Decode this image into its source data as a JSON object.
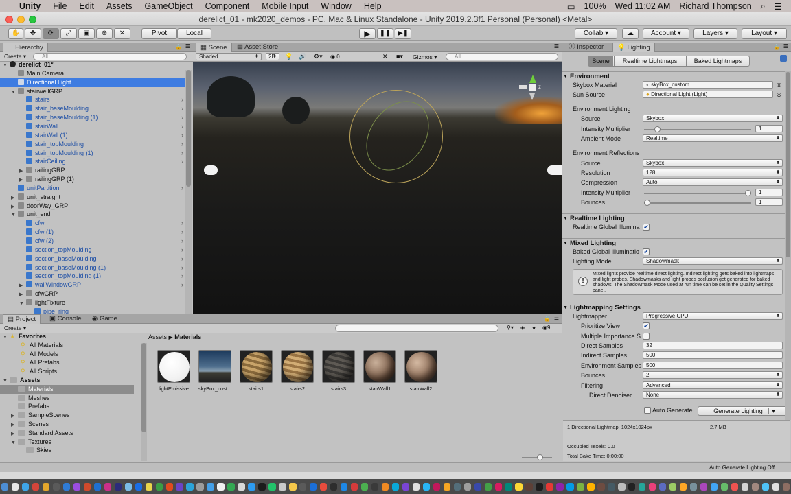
{
  "menubar": {
    "apple": "",
    "app": "Unity",
    "items": [
      "File",
      "Edit",
      "Assets",
      "GameObject",
      "Component",
      "Mobile Input",
      "Window",
      "Help"
    ],
    "battery": "100%",
    "clock": "Wed 11:02 AM",
    "user": "Richard Thompson"
  },
  "window": {
    "title": "derelict_01 - mk2020_demos - PC, Mac & Linux Standalone - Unity 2019.2.3f1 Personal (Personal) <Metal>"
  },
  "toolbar": {
    "pivot": "Pivot",
    "local": "Local",
    "collab": "Collab",
    "account": "Account",
    "layers": "Layers",
    "layout": "Layout"
  },
  "hierarchy": {
    "tab": "Hierarchy",
    "create": "Create",
    "search_placeholder": "All",
    "rows": [
      {
        "label": "derelict_01*",
        "indent": 0,
        "arrow": "▼",
        "icon": "unity",
        "bold": true
      },
      {
        "label": "Main Camera",
        "indent": 1,
        "arrow": "",
        "icon": "go"
      },
      {
        "label": "Directional Light",
        "indent": 1,
        "arrow": "",
        "icon": "go",
        "selected": true
      },
      {
        "label": "stairwellGRP",
        "indent": 1,
        "arrow": "▼",
        "icon": "go"
      },
      {
        "label": "stairs",
        "indent": 2,
        "arrow": "",
        "icon": "prefab",
        "chev": true
      },
      {
        "label": "stair_baseMoulding",
        "indent": 2,
        "arrow": "",
        "icon": "prefab",
        "chev": true
      },
      {
        "label": "stair_baseMoulding (1)",
        "indent": 2,
        "arrow": "",
        "icon": "prefab",
        "chev": true
      },
      {
        "label": "stairWall",
        "indent": 2,
        "arrow": "",
        "icon": "prefab",
        "chev": true
      },
      {
        "label": "stairWall (1)",
        "indent": 2,
        "arrow": "",
        "icon": "prefab",
        "chev": true
      },
      {
        "label": "stair_topMoulding",
        "indent": 2,
        "arrow": "",
        "icon": "prefab",
        "chev": true
      },
      {
        "label": "stair_topMoulding (1)",
        "indent": 2,
        "arrow": "",
        "icon": "prefab",
        "chev": true
      },
      {
        "label": "stairCeiling",
        "indent": 2,
        "arrow": "",
        "icon": "prefab",
        "chev": true
      },
      {
        "label": "railingGRP",
        "indent": 2,
        "arrow": "▶",
        "icon": "go"
      },
      {
        "label": "railingGRP (1)",
        "indent": 2,
        "arrow": "▶",
        "icon": "go"
      },
      {
        "label": "unitPartition",
        "indent": 1,
        "arrow": "",
        "icon": "prefab",
        "chev": true
      },
      {
        "label": "unit_straight",
        "indent": 1,
        "arrow": "▶",
        "icon": "go"
      },
      {
        "label": "doorWay_GRP",
        "indent": 1,
        "arrow": "▶",
        "icon": "go"
      },
      {
        "label": "unit_end",
        "indent": 1,
        "arrow": "▼",
        "icon": "go"
      },
      {
        "label": "cfw",
        "indent": 2,
        "arrow": "",
        "icon": "prefab",
        "chev": true
      },
      {
        "label": "cfw (1)",
        "indent": 2,
        "arrow": "",
        "icon": "prefab",
        "chev": true
      },
      {
        "label": "cfw (2)",
        "indent": 2,
        "arrow": "",
        "icon": "prefab",
        "chev": true
      },
      {
        "label": "section_topMoulding",
        "indent": 2,
        "arrow": "",
        "icon": "prefab",
        "chev": true
      },
      {
        "label": "section_baseMoulding",
        "indent": 2,
        "arrow": "",
        "icon": "prefab",
        "chev": true
      },
      {
        "label": "section_baseMoulding (1)",
        "indent": 2,
        "arrow": "",
        "icon": "prefab",
        "chev": true
      },
      {
        "label": "section_topMoulding (1)",
        "indent": 2,
        "arrow": "",
        "icon": "prefab",
        "chev": true
      },
      {
        "label": "wallWindowGRP",
        "indent": 2,
        "arrow": "▶",
        "icon": "prefab",
        "chev": true
      },
      {
        "label": "cfwGRP",
        "indent": 2,
        "arrow": "▶",
        "icon": "go"
      },
      {
        "label": "lightFixture",
        "indent": 2,
        "arrow": "▼",
        "icon": "go"
      },
      {
        "label": "pipe_ring",
        "indent": 3,
        "arrow": "",
        "icon": "prefab"
      }
    ]
  },
  "scene": {
    "tab_scene": "Scene",
    "tab_store": "Asset Store",
    "shading": "Shaded",
    "mode2d": "2D",
    "fx_count": "0",
    "gizmos": "Gizmos",
    "search_placeholder": "All",
    "persp_label": "z"
  },
  "project": {
    "tab_project": "Project",
    "tab_console": "Console",
    "tab_game": "Game",
    "create": "Create",
    "badge": "9",
    "breadcrumb": [
      "Assets",
      "Materials"
    ],
    "favorites": {
      "label": "Favorites",
      "items": [
        "All Materials",
        "All Models",
        "All Prefabs",
        "All Scripts"
      ]
    },
    "assets": {
      "label": "Assets",
      "items": [
        {
          "label": "Materials",
          "selected": true
        },
        {
          "label": "Meshes"
        },
        {
          "label": "Prefabs"
        },
        {
          "label": "SampleScenes",
          "arrow": true
        },
        {
          "label": "Scenes",
          "arrow": true
        },
        {
          "label": "Standard Assets",
          "arrow": true
        },
        {
          "label": "Textures",
          "arrow": true,
          "open": true
        }
      ],
      "sub": "Skies"
    },
    "materials": [
      {
        "name": "lightEmissive",
        "style": "white"
      },
      {
        "name": "skyBox_cust...",
        "style": "sky"
      },
      {
        "name": "stairs1",
        "style": "wood1"
      },
      {
        "name": "stairs2",
        "style": "wood2"
      },
      {
        "name": "stairs3",
        "style": "dark"
      },
      {
        "name": "stairWall1",
        "style": "wall1"
      },
      {
        "name": "stairWall2",
        "style": "wall2"
      }
    ]
  },
  "inspector": {
    "tab_inspector": "Inspector",
    "tab_lighting": "Lighting",
    "subtabs": [
      "Scene",
      "Realtime Lightmaps",
      "Baked Lightmaps"
    ],
    "environment": {
      "header": "Environment",
      "skybox_label": "Skybox Material",
      "skybox_value": "skyBox_custom",
      "sun_label": "Sun Source",
      "sun_value": "Directional Light (Light)",
      "env_lighting": "Environment Lighting",
      "source_label": "Source",
      "source_value": "Skybox",
      "intensity_label": "Intensity Multiplier",
      "intensity_value": "1",
      "intensity_level": 0.1,
      "ambient_label": "Ambient Mode",
      "ambient_value": "Realtime",
      "env_reflections": "Environment Reflections",
      "r_source_label": "Source",
      "r_source_value": "Skybox",
      "resolution_label": "Resolution",
      "resolution_value": "128",
      "compression_label": "Compression",
      "compression_value": "Auto",
      "r_intensity_label": "Intensity Multiplier",
      "r_intensity_value": "1",
      "r_intensity_level": 1.0,
      "bounces_label": "Bounces",
      "bounces_value": "1",
      "bounces_level": 0.0
    },
    "realtime": {
      "header": "Realtime Lighting",
      "gi_label": "Realtime Global Illumina",
      "gi_checked": "✔"
    },
    "mixed": {
      "header": "Mixed Lighting",
      "baked_label": "Baked Global Illuminatio",
      "baked_checked": "✔",
      "mode_label": "Lighting Mode",
      "mode_value": "Shadowmask",
      "info": "Mixed lights provide realtime direct lighting. Indirect lighting gets baked into lightmaps and light probes. Shadowmasks and light probes occlusion get generated for baked shadows. The Shadowmask Mode used at run time can be set in the Quality Settings panel."
    },
    "lightmapping": {
      "header": "Lightmapping Settings",
      "lightmapper_label": "Lightmapper",
      "lightmapper_value": "Progressive CPU",
      "prioritize_label": "Prioritize View",
      "prioritize_checked": "✔",
      "importance_label": "Multiple Importance S",
      "direct_label": "Direct Samples",
      "direct_value": "32",
      "indirect_label": "Indirect Samples",
      "indirect_value": "500",
      "env_samples_label": "Environment Samples",
      "env_samples_value": "500",
      "bounces_label": "Bounces",
      "bounces_value": "2",
      "filtering_label": "Filtering",
      "filtering_value": "Advanced",
      "denoiser_label": "Direct Denoiser",
      "denoiser_value": "None"
    },
    "auto_generate": "Auto Generate",
    "generate_button": "Generate Lighting",
    "stats": {
      "lightmap": "1 Directional Lightmap: 1024x1024px",
      "size": "2.7 MB",
      "occupied": "Occupied Texels: 0.0",
      "bake_time": "Total Bake Time: 0:00:00"
    }
  },
  "status": {
    "right": "Auto Generate Lighting Off"
  },
  "dock_colors": [
    "#4d8fd6",
    "#e9e9e9",
    "#3fa5e6",
    "#d2453a",
    "#e4a72c",
    "#5a5a5a",
    "#2f7bd4",
    "#9b4de0",
    "#d04a2c",
    "#1f6fd1",
    "#cc2f8a",
    "#2c2c7a",
    "#7bbde7",
    "#1a6ee4",
    "#e9d54a",
    "#3a9d45",
    "#e04a1f",
    "#6b44c8",
    "#2ba4d9",
    "#9c9c9c",
    "#44a0e8",
    "#f0f0f0",
    "#34a853",
    "#d8d8d8",
    "#2d9bf0",
    "#1b1b1b",
    "#22c26a",
    "#c9c9c9",
    "#f4c74a",
    "#5a5a5a",
    "#1b6fd8",
    "#e84c3d",
    "#2d2d2d",
    "#1e88e5",
    "#d63b3b",
    "#4caf50",
    "#3a3a3a",
    "#ef8a23",
    "#0aa8d8",
    "#7a45d6",
    "#e0e0e0",
    "#29b6f6",
    "#c2185b",
    "#f5a623",
    "#546e7a",
    "#9e9e9e",
    "#3949ab",
    "#43a047",
    "#d81b60",
    "#00897b",
    "#fdd835",
    "#5d4037",
    "#1e1e1e",
    "#e53935",
    "#8e24aa",
    "#039be5",
    "#7cb342",
    "#ffb300",
    "#6d4c41",
    "#455a64",
    "#bdbdbd",
    "#212121",
    "#26a69a",
    "#ec407a",
    "#5c6bc0",
    "#9ccc65",
    "#ffa726",
    "#78909c",
    "#ab47bc",
    "#42a5f5",
    "#66bb6a",
    "#ef5350",
    "#d4d4d4",
    "#a1887f",
    "#4fc3f7",
    "#e0e0e0",
    "#8d6e63"
  ]
}
